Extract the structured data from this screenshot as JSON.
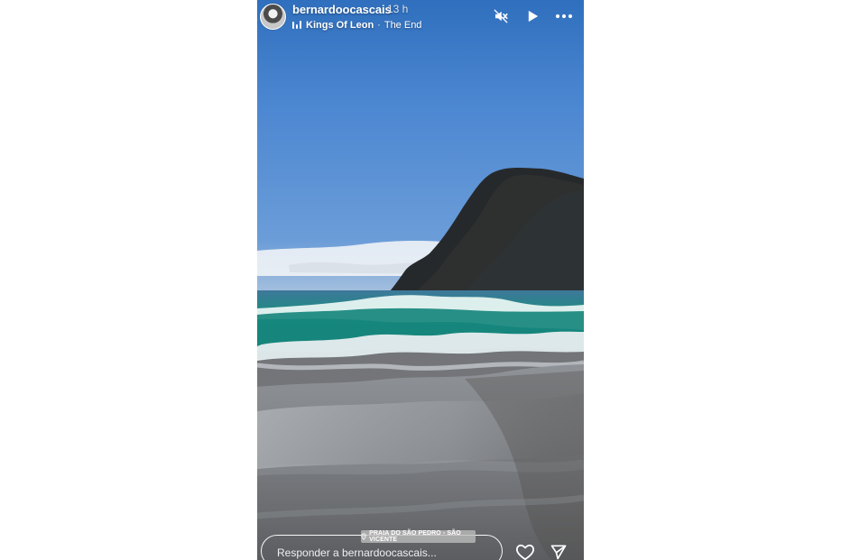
{
  "story": {
    "username": "bernardoocascais",
    "time": "13 h",
    "music_artist": "Kings Of Leon",
    "music_separator": "·",
    "music_song": "The End",
    "location": "PRAIA DO SÃO PEDRO - SÃO VICENTE",
    "reply_placeholder": "Responder a bernardoocascais..."
  },
  "icons": {
    "mute": "mute-icon",
    "play": "play-icon",
    "more": "more-icon",
    "location": "location-pin-icon",
    "like": "heart-icon",
    "share": "send-icon"
  },
  "colors": {
    "sky_top": "#4b82c9",
    "sea": "#1f7a76",
    "sand": "#75777a",
    "text": "#ffffff"
  }
}
